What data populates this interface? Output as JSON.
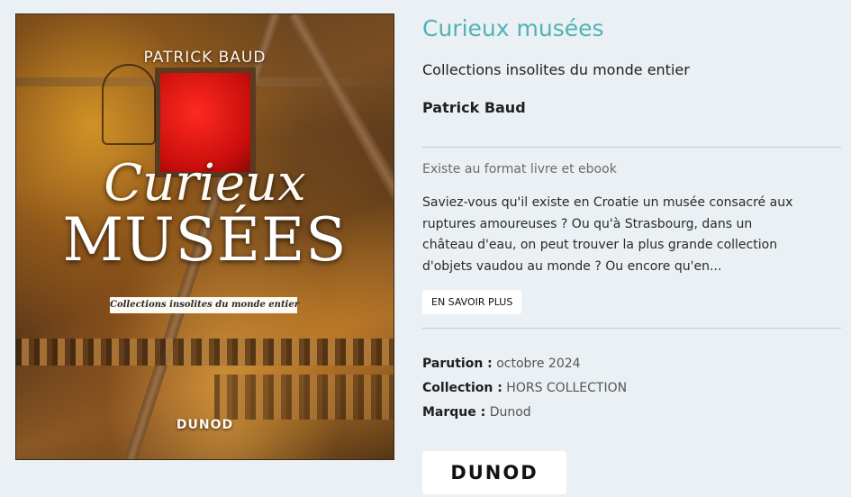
{
  "book": {
    "title": "Curieux musées",
    "subtitle": "Collections insolites du monde entier",
    "author": "Patrick Baud",
    "formats": "Existe au format livre et ebook",
    "summary": "Saviez-vous qu'il existe en Croatie un musée consacré aux\nruptures amoureuses ? Ou qu'à Strasbourg, dans un\nchâteau d'eau, on peut trouver la plus grande collection\nd'objets vaudou au monde ? Ou encore qu'en...",
    "more_label": "EN SAVOIR PLUS"
  },
  "cover": {
    "author": "PATRICK BAUD",
    "title_line1": "Curieux",
    "title_line2": "MUSÉES",
    "subtitle": "Collections insolites du monde entier",
    "publisher": "DUNOD"
  },
  "meta": {
    "parution_label": "Parution :",
    "parution_value": "octobre 2024",
    "collection_label": "Collection :",
    "collection_value": "HORS COLLECTION",
    "marque_label": "Marque :",
    "marque_value": "Dunod"
  },
  "brand": {
    "logo": "DUNOD"
  },
  "colors": {
    "background": "#eaf0f3",
    "title": "#4fb3b5",
    "rule": "#b9d3d5"
  }
}
